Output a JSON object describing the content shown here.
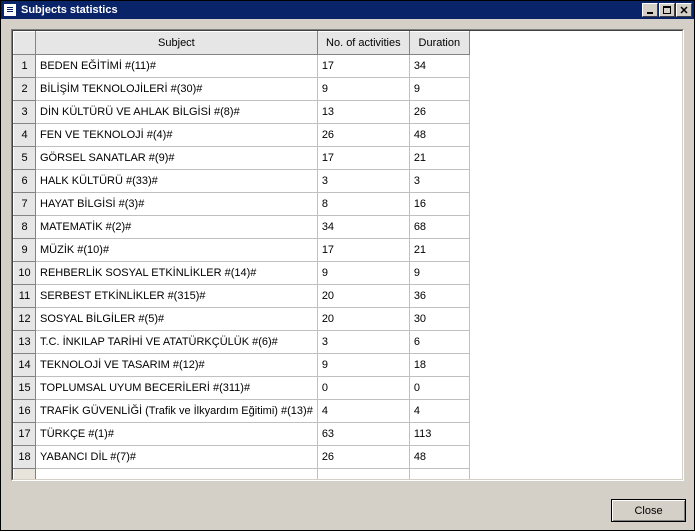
{
  "window": {
    "title": "Subjects statistics"
  },
  "table": {
    "headers": {
      "subject": "Subject",
      "activities": "No. of activities",
      "duration": "Duration"
    },
    "rows": [
      {
        "n": "1",
        "subject": "BEDEN EĞİTİMİ #(11)#",
        "acts": "17",
        "dur": "34"
      },
      {
        "n": "2",
        "subject": "BİLİŞİM TEKNOLOJİLERİ #(30)#",
        "acts": "9",
        "dur": "9"
      },
      {
        "n": "3",
        "subject": "DİN KÜLTÜRÜ VE AHLAK BİLGİSİ #(8)#",
        "acts": "13",
        "dur": "26"
      },
      {
        "n": "4",
        "subject": "FEN VE TEKNOLOJİ #(4)#",
        "acts": "26",
        "dur": "48"
      },
      {
        "n": "5",
        "subject": "GÖRSEL SANATLAR #(9)#",
        "acts": "17",
        "dur": "21"
      },
      {
        "n": "6",
        "subject": "HALK KÜLTÜRÜ #(33)#",
        "acts": "3",
        "dur": "3"
      },
      {
        "n": "7",
        "subject": "HAYAT BİLGİSİ #(3)#",
        "acts": "8",
        "dur": "16"
      },
      {
        "n": "8",
        "subject": "MATEMATİK #(2)#",
        "acts": "34",
        "dur": "68"
      },
      {
        "n": "9",
        "subject": "MÜZİK #(10)#",
        "acts": "17",
        "dur": "21"
      },
      {
        "n": "10",
        "subject": "REHBERLİK SOSYAL ETKİNLİKLER #(14)#",
        "acts": "9",
        "dur": "9"
      },
      {
        "n": "11",
        "subject": "SERBEST ETKİNLİKLER #(315)#",
        "acts": "20",
        "dur": "36"
      },
      {
        "n": "12",
        "subject": "SOSYAL BİLGİLER #(5)#",
        "acts": "20",
        "dur": "30"
      },
      {
        "n": "13",
        "subject": "T.C. İNKILAP TARİHİ VE ATATÜRKÇÜLÜK #(6)#",
        "acts": "3",
        "dur": "6"
      },
      {
        "n": "14",
        "subject": "TEKNOLOJİ VE TASARIM #(12)#",
        "acts": "9",
        "dur": "18"
      },
      {
        "n": "15",
        "subject": "TOPLUMSAL UYUM BECERİLERİ #(311)#",
        "acts": "0",
        "dur": "0"
      },
      {
        "n": "16",
        "subject": "TRAFİK GÜVENLİĞİ (Trafik ve İlkyardım Eğitimi) #(13)#",
        "acts": "4",
        "dur": "4"
      },
      {
        "n": "17",
        "subject": "TÜRKÇE #(1)#",
        "acts": "63",
        "dur": "113"
      },
      {
        "n": "18",
        "subject": "YABANCI DİL #(7)#",
        "acts": "26",
        "dur": "48"
      }
    ]
  },
  "buttons": {
    "close": "Close"
  }
}
